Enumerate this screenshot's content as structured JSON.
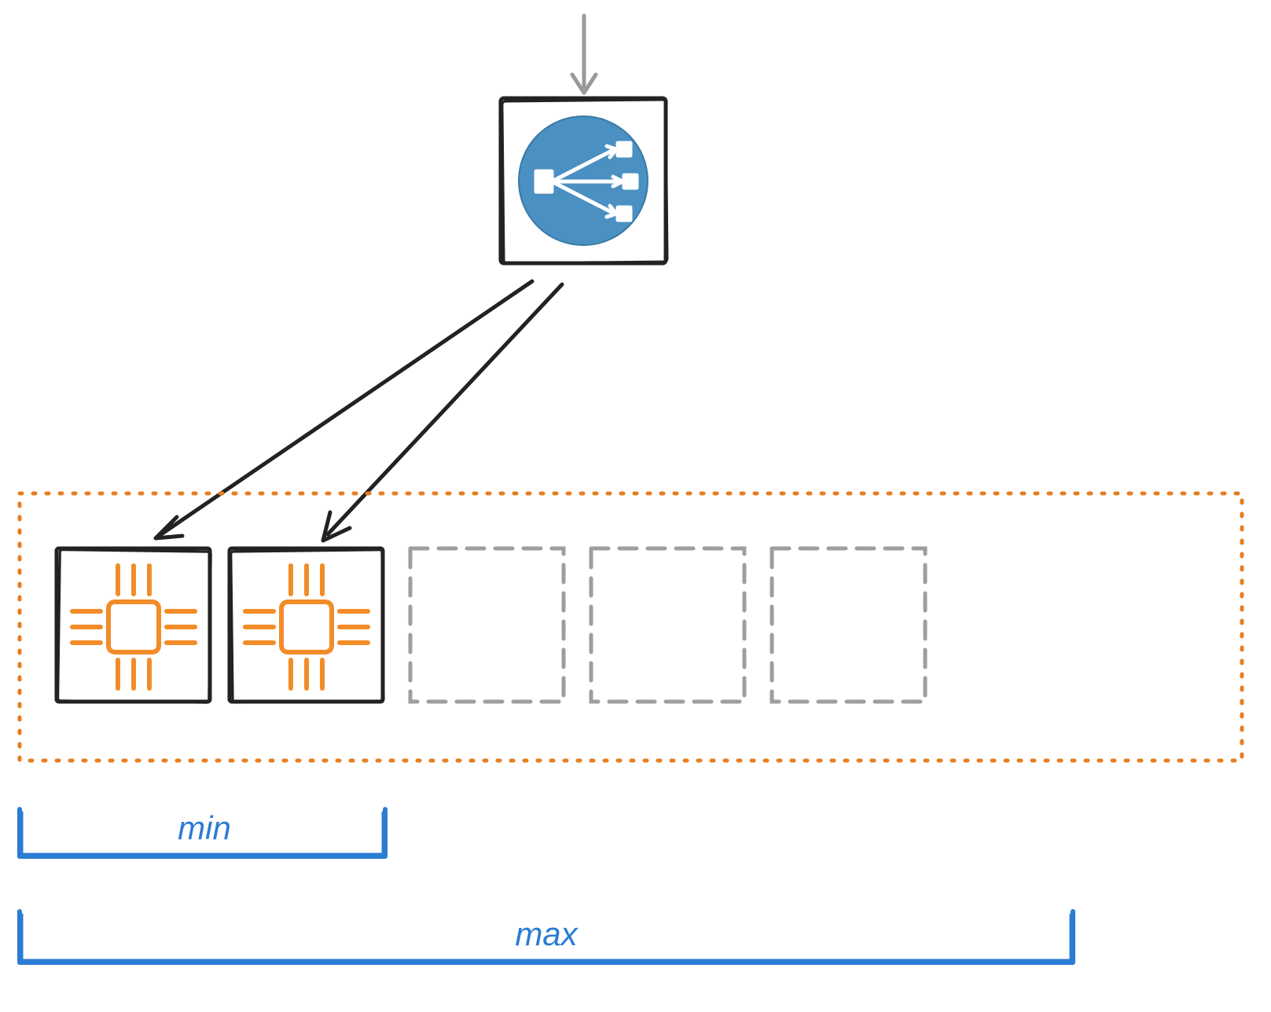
{
  "labels": {
    "min": "min",
    "max": "max"
  },
  "colors": {
    "accent_blue": "#2b7cd3",
    "load_balancer_fill": "#4a90c2",
    "cpu_orange": "#f28c28",
    "dotted_orange": "#e67e22",
    "box_dark": "#222222",
    "placeholder_gray": "#9e9e9e",
    "incoming_arrow_gray": "#999999"
  },
  "diagram": {
    "active_nodes": 2,
    "placeholder_nodes": 3,
    "total_capacity": 5
  }
}
